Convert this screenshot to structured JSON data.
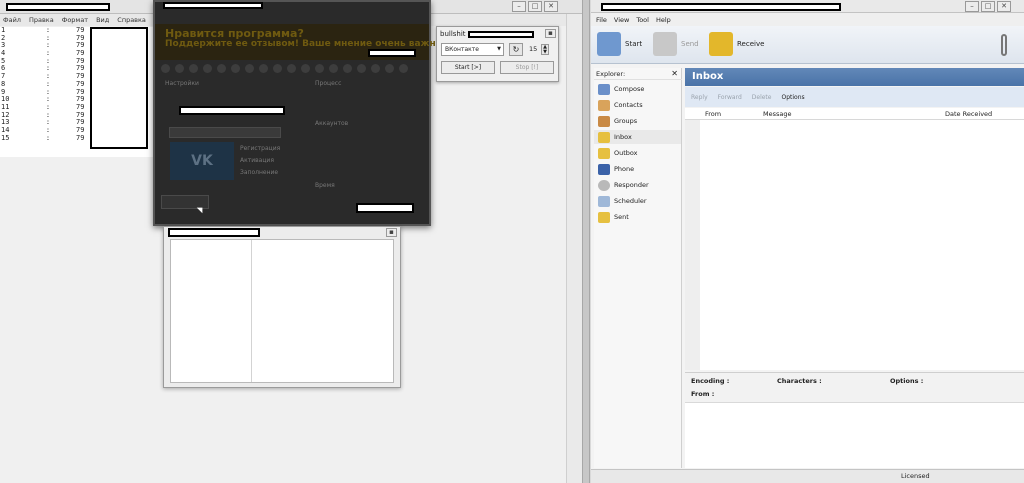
{
  "notepad": {
    "menu": [
      "Файл",
      "Правка",
      "Формат",
      "Вид",
      "Справка"
    ],
    "lines": [
      {
        "n": "1",
        "v": "79"
      },
      {
        "n": "2",
        "v": "79"
      },
      {
        "n": "3",
        "v": "79"
      },
      {
        "n": "4",
        "v": "79"
      },
      {
        "n": "5",
        "v": "79"
      },
      {
        "n": "6",
        "v": "79"
      },
      {
        "n": "7",
        "v": "79"
      },
      {
        "n": "8",
        "v": "79"
      },
      {
        "n": "9",
        "v": "79"
      },
      {
        "n": "10",
        "v": "79"
      },
      {
        "n": "11",
        "v": "79"
      },
      {
        "n": "12",
        "v": "79"
      },
      {
        "n": "13",
        "v": "79"
      },
      {
        "n": "14",
        "v": "79"
      },
      {
        "n": "15",
        "v": "79"
      }
    ]
  },
  "dark_dialog": {
    "headline": "Нравится программа?",
    "subhead": "Поддержите ее отзывом! Ваше мнение очень важно!",
    "settings_label": "Настройки",
    "process_label": "Процесс",
    "vk_label": "VK",
    "accounts_label": "Аккаунтов",
    "time_label": "Время",
    "checks": [
      "Регистрация",
      "Активация",
      "Заполнение"
    ]
  },
  "bullshit_window": {
    "title": "bullshit",
    "select_value": "ВКонтакте",
    "count_value": "15",
    "start_label": "Start [>]",
    "stop_label": "Stop [!]"
  },
  "app": {
    "menu": [
      "File",
      "View",
      "Tool",
      "Help"
    ],
    "toolbar": {
      "start": "Start",
      "send": "Send",
      "receive": "Receive"
    },
    "explorer_title": "Explorer:",
    "explorer_items": [
      "Compose",
      "Contacts",
      "Groups",
      "Inbox",
      "Outbox",
      "Phone",
      "Responder",
      "Scheduler",
      "Sent"
    ],
    "inbox_title": "Inbox",
    "inbox_tools": {
      "reply": "Reply",
      "forward": "Forward",
      "delete": "Delete",
      "options": "Options"
    },
    "columns": {
      "from": "From",
      "message": "Message",
      "date": "Date Received"
    },
    "preview": {
      "encoding": "Encoding :",
      "characters": "Characters :",
      "options": "Options :",
      "from": "From :"
    },
    "status": "Licensed"
  }
}
